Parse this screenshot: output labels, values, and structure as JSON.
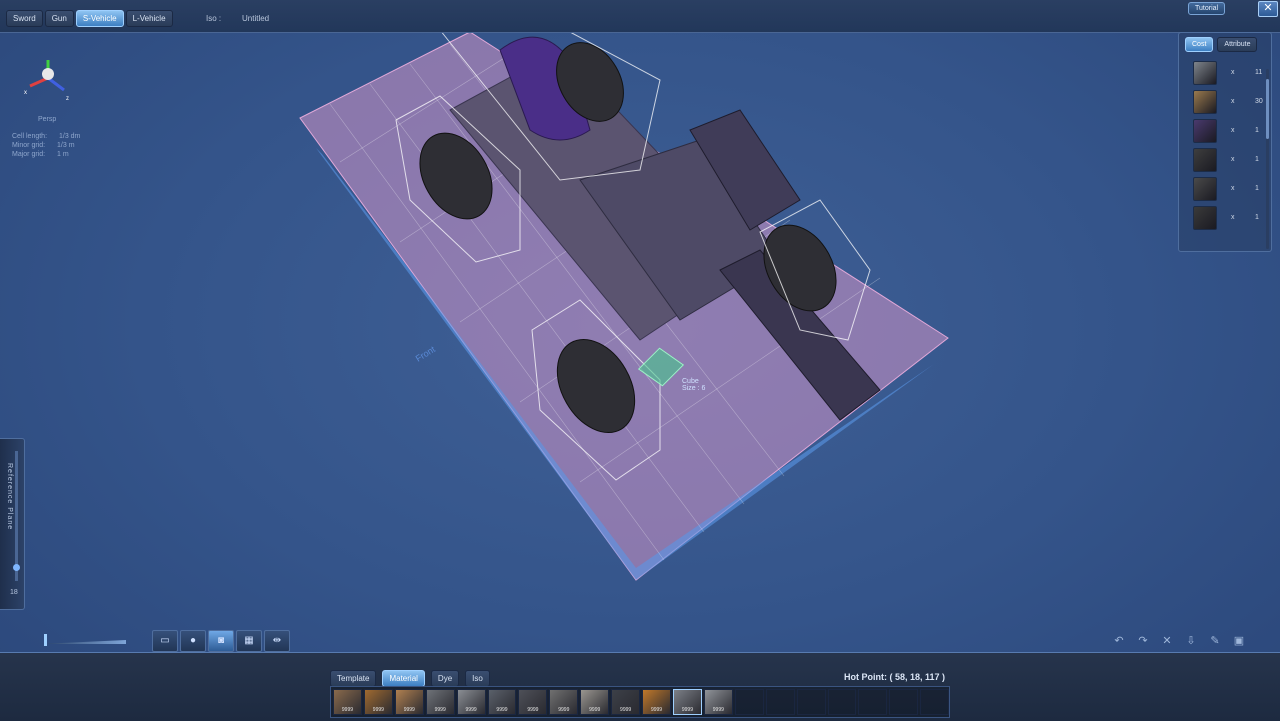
{
  "top": {
    "mode_tabs": [
      "Sword",
      "Gun",
      "S-Vehicle",
      "L-Vehicle"
    ],
    "active_mode": "S-Vehicle",
    "iso_label": "Iso :",
    "iso_name": "Untitled",
    "tutorial_label": "Tutorial",
    "close_glyph": "✕"
  },
  "view": {
    "projection_label": "Persp",
    "gizmo_axes": [
      "x",
      "z"
    ],
    "grid_info": [
      {
        "label": "Cell length:",
        "value": "1/3 dm"
      },
      {
        "label": "Minor grid:",
        "value": "1/3 m"
      },
      {
        "label": "Major grid:",
        "value": "1 m"
      }
    ],
    "cursor_label": [
      "Cube",
      "Size : 6"
    ],
    "front_marker": "Front"
  },
  "cost_panel": {
    "tabs": [
      "Cost",
      "Attribute"
    ],
    "active_tab": "Cost",
    "items": [
      {
        "icon": "metal-block-icon",
        "color": "#7f858c",
        "mult": "x",
        "count": "11"
      },
      {
        "icon": "wood-block-icon",
        "color": "#9a7a4e",
        "mult": "x",
        "count": "30"
      },
      {
        "icon": "vehicle-seat-icon",
        "color": "#4a3a6e",
        "mult": "x",
        "count": "1"
      },
      {
        "icon": "wheel-icon",
        "color": "#3e3e3e",
        "mult": "x",
        "count": "1"
      },
      {
        "icon": "wheel-icon",
        "color": "#4a4a4a",
        "mult": "x",
        "count": "1"
      },
      {
        "icon": "wheel-icon",
        "color": "#3a3a3a",
        "mult": "x",
        "count": "1"
      }
    ]
  },
  "reference_plane": {
    "label": "Reference Plane",
    "value": "18",
    "level": 0.9
  },
  "view_tools": [
    "frame-icon",
    "sphere-icon",
    "camera-icon",
    "grid-icon",
    "mirror-icon"
  ],
  "edit_tools": [
    "undo-icon",
    "redo-icon",
    "trash-icon",
    "export-icon",
    "paint-icon",
    "save-icon"
  ],
  "library": {
    "tabs": [
      "Template",
      "Material",
      "Dye",
      "Iso"
    ],
    "active_tab": "Material",
    "hot_point_label": "Hot Point: ( 58, 18, 117 )",
    "materials": [
      {
        "color": "#8a6a4c",
        "qty": "9999"
      },
      {
        "color": "#a06a30",
        "qty": "9999"
      },
      {
        "color": "#b08050",
        "qty": "9999"
      },
      {
        "color": "#6e7278",
        "qty": "9999"
      },
      {
        "color": "#8a8e94",
        "qty": "9999"
      },
      {
        "color": "#5a606a",
        "qty": "9999"
      },
      {
        "color": "#4e5058",
        "qty": "9999"
      },
      {
        "color": "#707070",
        "qty": "9999"
      },
      {
        "color": "#9a9690",
        "qty": "9999"
      },
      {
        "color": "#3c4048",
        "qty": "9999"
      },
      {
        "color": "#c0782a",
        "qty": "9999"
      },
      {
        "color": "#7c8088",
        "qty": "9999"
      },
      {
        "color": "#90949a",
        "qty": "9999"
      },
      {
        "color": "",
        "qty": ""
      },
      {
        "color": "",
        "qty": ""
      },
      {
        "color": "",
        "qty": ""
      },
      {
        "color": "",
        "qty": ""
      },
      {
        "color": "",
        "qty": ""
      },
      {
        "color": "",
        "qty": ""
      },
      {
        "color": "",
        "qty": ""
      }
    ],
    "selected_index": 11
  }
}
